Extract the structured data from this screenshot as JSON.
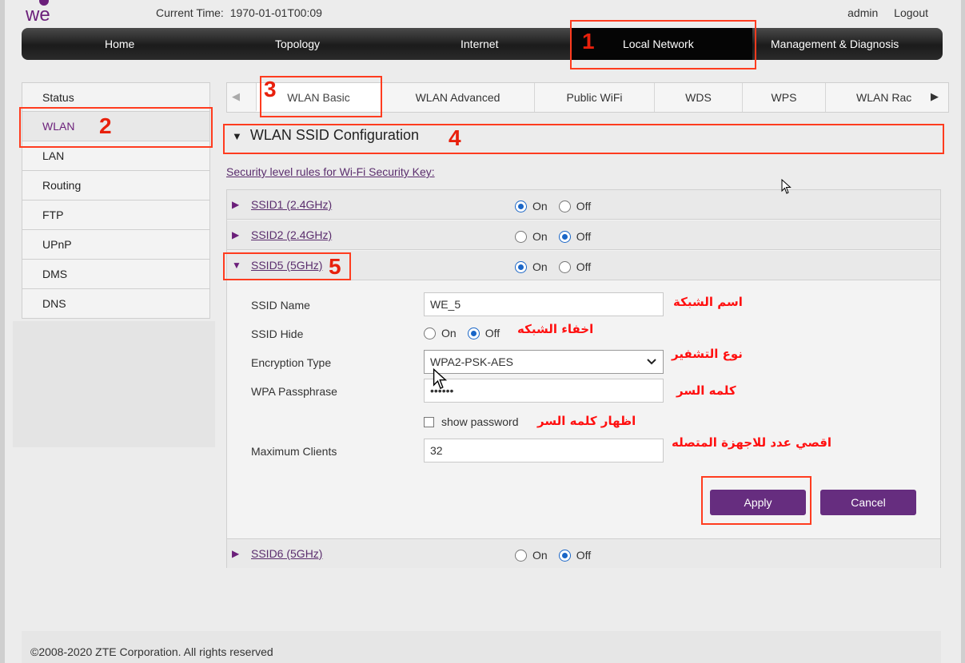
{
  "header": {
    "logo_text": "we",
    "current_time_label": "Current Time:",
    "current_time_value": "1970-01-01T00:09",
    "user": "admin",
    "logout": "Logout"
  },
  "main_nav": [
    "Home",
    "Topology",
    "Internet",
    "Local Network",
    "Management & Diagnosis"
  ],
  "sidebar": [
    "Status",
    "WLAN",
    "LAN",
    "Routing",
    "FTP",
    "UPnP",
    "DMS",
    "DNS"
  ],
  "tabs": [
    "WLAN Basic",
    "WLAN Advanced",
    "Public WiFi",
    "WDS",
    "WPS",
    "WLAN Rac"
  ],
  "section_title": "WLAN SSID Configuration",
  "security_link": "Security level rules for Wi-Fi Security Key:",
  "ssids": [
    {
      "name": "SSID1 (2.4GHz)",
      "state": "On"
    },
    {
      "name": "SSID2 (2.4GHz)",
      "state": "Off"
    },
    {
      "name": "SSID5 (5GHz)",
      "state": "On"
    },
    {
      "name": "SSID6 (5GHz)",
      "state": "Off"
    }
  ],
  "radio_on": "On",
  "radio_off": "Off",
  "form": {
    "ssid_name_label": "SSID Name",
    "ssid_name_value": "WE_5",
    "ssid_hide_label": "SSID Hide",
    "ssid_hide_state": "Off",
    "encryption_label": "Encryption Type",
    "encryption_value": "WPA2-PSK-AES",
    "passphrase_label": "WPA Passphrase",
    "passphrase_value": "••••••",
    "show_password": "show password",
    "max_clients_label": "Maximum Clients",
    "max_clients_value": "32"
  },
  "buttons": {
    "apply": "Apply",
    "cancel": "Cancel"
  },
  "annotations": {
    "numbers": [
      "1",
      "2",
      "3",
      "4",
      "5"
    ],
    "network_name": "اسم الشبكة",
    "hide_network": "اخفاء الشبكه",
    "encryption_type": "نوع التشفير",
    "password": "كلمه السر",
    "show_password": "اظهار كلمه السر",
    "max_devices": "اقصي عدد للاجهزة المتصله"
  },
  "footer": "©2008-2020 ZTE Corporation. All rights reserved",
  "colors": {
    "accent": "#662d7f",
    "highlight": "#ff3c1f",
    "radio": "#1a66c7"
  }
}
